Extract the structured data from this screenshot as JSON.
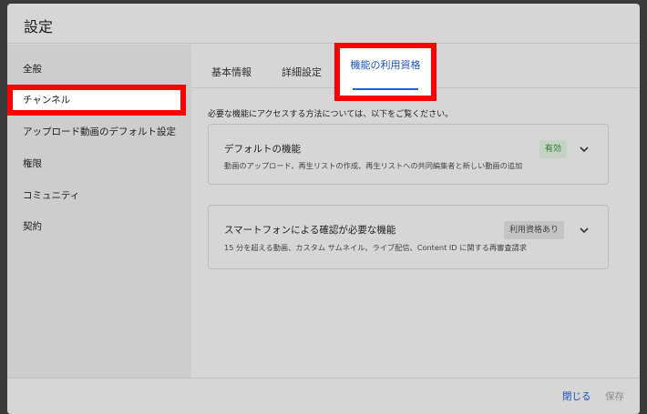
{
  "dialog": {
    "title": "設定"
  },
  "sidebar": {
    "items": [
      {
        "label": "全般"
      },
      {
        "label": "チャンネル"
      },
      {
        "label": "アップロード動画のデフォルト設定"
      },
      {
        "label": "権限"
      },
      {
        "label": "コミュニティ"
      },
      {
        "label": "契約"
      }
    ]
  },
  "tabs": [
    {
      "label": "基本情報"
    },
    {
      "label": "詳細設定"
    },
    {
      "label": "機能の利用資格"
    }
  ],
  "main": {
    "description": "必要な機能にアクセスする方法については、以下をご覧ください。",
    "cards": [
      {
        "title": "デフォルトの機能",
        "subtitle": "動画のアップロード、再生リストの作成、再生リストへの共同編集者と新しい動画の追加",
        "badge": "有効"
      },
      {
        "title": "スマートフォンによる確認が必要な機能",
        "subtitle": "15 分を超える動画、カスタム サムネイル、ライブ配信、Content ID に関する再審査請求",
        "badge": "利用資格あり"
      }
    ]
  },
  "footer": {
    "close_label": "閉じる",
    "save_label": "保存"
  },
  "colors": {
    "accent": "#1a63d6",
    "highlight": "#ff0000",
    "enabled": "#2b7a2b"
  }
}
